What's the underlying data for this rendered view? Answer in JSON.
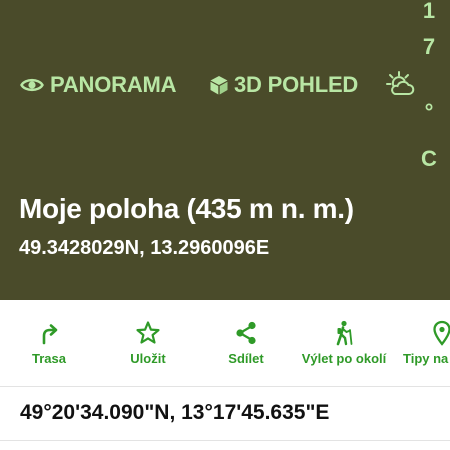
{
  "header": {
    "panorama_label": "PANORAMA",
    "view3d_label": "3D POHLED",
    "weather_icon": "partly-cloudy-sun-icon",
    "temperature_chars": [
      "1",
      "7",
      "°",
      "C"
    ],
    "title": "Moje poloha (435 m n. m.)",
    "coordinates": "49.3428029N, 13.2960096E"
  },
  "actions": [
    {
      "label": "Trasa",
      "icon": "route-turn-icon"
    },
    {
      "label": "Uložit",
      "icon": "star-icon"
    },
    {
      "label": "Sdílet",
      "icon": "share-icon"
    },
    {
      "label": "Výlet po okolí",
      "icon": "hiker-icon"
    },
    {
      "label": "Tipy na",
      "icon": "map-pin-icon"
    }
  ],
  "coordinates_dms": "49°20'34.090\"N, 13°17'45.635\"E",
  "colors": {
    "header_bg": "#4a4b2a",
    "accent_light_green": "#b8e6a4",
    "action_green": "#2f9a28",
    "title_text": "#ffffff"
  }
}
